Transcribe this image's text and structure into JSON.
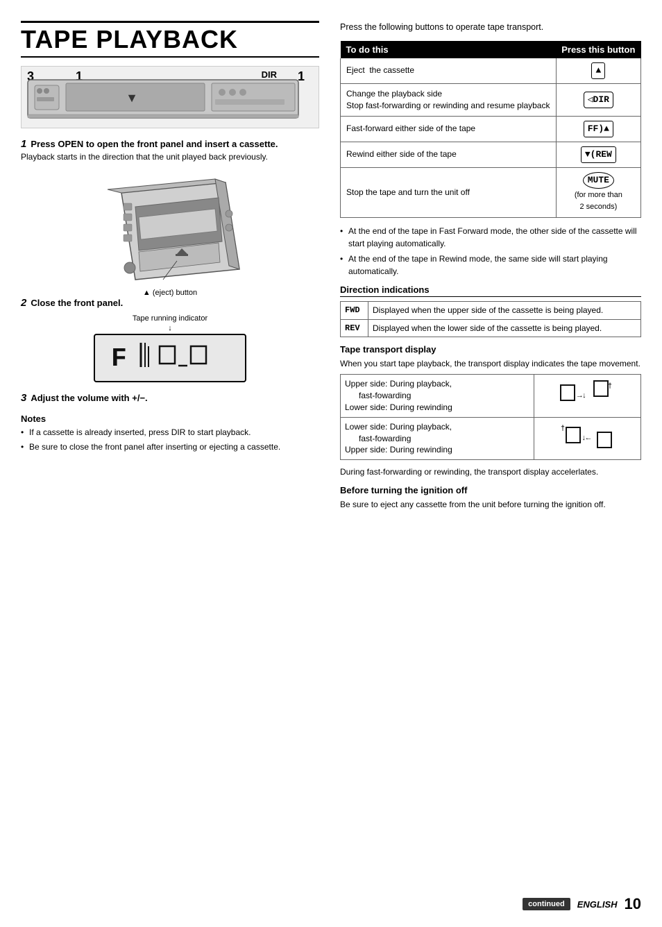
{
  "page": {
    "title": "TAPE PLAYBACK",
    "language": "ENGLISH",
    "page_number": "10",
    "continued_label": "continued"
  },
  "left": {
    "diagram_labels": {
      "num3": "3",
      "num1": "1",
      "dir": "DIR",
      "num1right": "1"
    },
    "steps": [
      {
        "num": "1",
        "title": "Press OPEN to open the front panel and insert a cassette.",
        "body": "Playback starts in the direction that the unit played back previously."
      },
      {
        "num": "2",
        "title": "Close the front panel.",
        "tape_indicator_label": "Tape running indicator",
        "display_text": "F▌▌▌  □_□"
      },
      {
        "num": "3",
        "title": "Adjust the volume with +/−.",
        "title_symbol": "+/−"
      }
    ],
    "eject_label": "▲ (eject) button",
    "notes": {
      "title": "Notes",
      "items": [
        "If a cassette is already inserted, press DIR to start playback.",
        "Be sure to close the front panel after inserting or ejecting a cassette."
      ]
    }
  },
  "right": {
    "intro": "Press the following buttons to operate tape transport.",
    "table": {
      "col1": "To do this",
      "col2": "Press this button",
      "rows": [
        {
          "action": "Eject  the cassette",
          "button": "▲",
          "button_style": "box"
        },
        {
          "action": "Change the playback side\nStop fast-forwarding or rewinding and resume playback",
          "button": "DIR",
          "button_style": "rounded-box"
        },
        {
          "action": "Fast-forward either side of the tape",
          "button": "FF)▲",
          "button_style": "box"
        },
        {
          "action": "Rewind either side of the tape",
          "button": "▼(REW",
          "button_style": "box"
        },
        {
          "action": "Stop the tape and turn the unit off",
          "button": "MUTE",
          "button_style": "round",
          "extra": "(for more than\n2 seconds)"
        }
      ]
    },
    "bullet_notes": [
      "At the end of the tape in Fast Forward mode, the other side of the cassette will start playing automatically.",
      "At the end of the tape in Rewind mode, the same side will start playing automatically."
    ],
    "direction_indications": {
      "heading": "Direction indications",
      "rows": [
        {
          "symbol": "FWD",
          "description": "Displayed when the upper side of the cassette is being played."
        },
        {
          "symbol": "REV",
          "description": "Displayed when the lower side of the cassette is being played."
        }
      ]
    },
    "tape_transport": {
      "heading": "Tape transport display",
      "intro": "When you start tape playback, the transport display indicates the tape movement.",
      "rows": [
        {
          "description": "Upper side: During playback,\n      fast-fowarding\nLower side: During rewinding",
          "display": "□ →↓□†"
        },
        {
          "description": "Lower side: During playback,\n      fast-fowarding\nUpper side: During rewinding",
          "display": "†□↓← □"
        }
      ],
      "note": "During fast-forwarding or rewinding, the transport display accelerlates."
    },
    "before_ignition": {
      "heading": "Before turning the ignition off",
      "body": "Be sure to eject any cassette from the unit before turning the ignition off."
    }
  }
}
